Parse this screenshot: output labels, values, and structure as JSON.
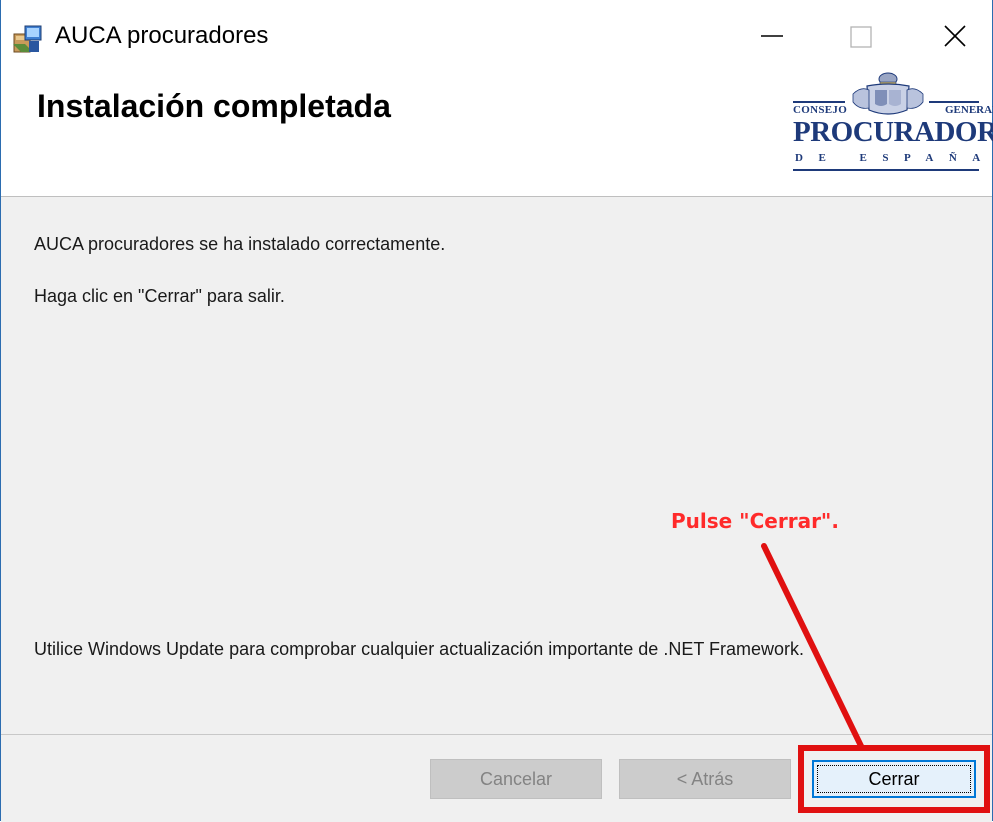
{
  "window": {
    "title": "AUCA procuradores",
    "icon": "installer-package-icon",
    "controls": [
      "minimize",
      "maximize",
      "close"
    ]
  },
  "header": {
    "title": "Instalación completada",
    "logo": {
      "line_left": "CONSEJO",
      "line_right": "GENERAL",
      "main": "PROCURADORES",
      "sub": "DE ESPAÑA"
    }
  },
  "content": {
    "message_success": "AUCA procuradores se ha instalado correctamente.",
    "message_instruction": "Haga clic en \"Cerrar\" para salir.",
    "message_update": "Utilice Windows Update para comprobar cualquier actualización importante de .NET Framework."
  },
  "annotation": {
    "text": "Pulse \"Cerrar\".",
    "color": "#ff2a2a"
  },
  "footer": {
    "cancel_label": "Cancelar",
    "back_label": "< Atrás",
    "close_label": "Cerrar"
  },
  "colors": {
    "accent": "#0078d7",
    "highlight": "#e01010",
    "logo_blue": "#1e3a7a"
  }
}
